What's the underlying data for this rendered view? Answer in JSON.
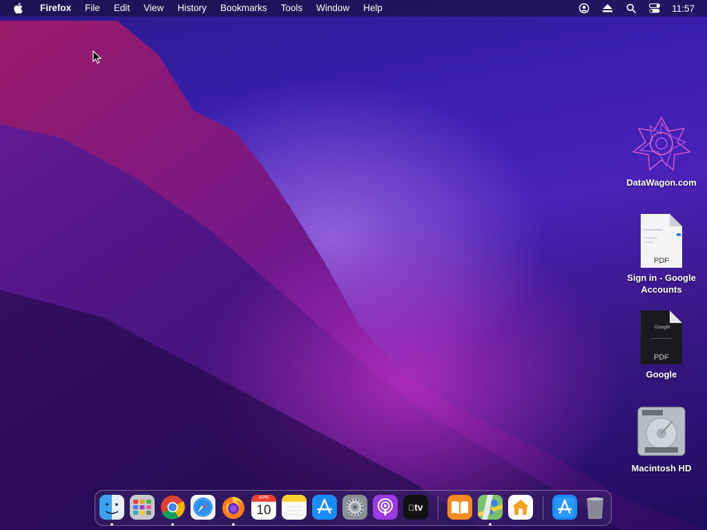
{
  "menubar": {
    "apple_icon": "apple-logo-icon",
    "app_name": "Firefox",
    "menus": [
      "File",
      "Edit",
      "View",
      "History",
      "Bookmarks",
      "Tools",
      "Window",
      "Help"
    ],
    "status_icons": [
      "user-account-icon",
      "eject-icon",
      "spotlight-search-icon",
      "control-center-icon"
    ],
    "clock": "11:57"
  },
  "desktop": {
    "icons": [
      {
        "name": "datawagon-icon",
        "label": "DataWagon.com",
        "kind": "app"
      },
      {
        "name": "pdf-sign-in-icon",
        "label": "Sign in - Google Accounts",
        "kind": "pdf",
        "tag": "PDF"
      },
      {
        "name": "pdf-google-icon",
        "label": "Google",
        "kind": "pdf-dark",
        "tag": "PDF"
      },
      {
        "name": "macintosh-hd-icon",
        "label": "Macintosh HD",
        "kind": "disk"
      }
    ]
  },
  "dock": {
    "apps": [
      {
        "name": "finder-icon",
        "running": true
      },
      {
        "name": "launchpad-icon",
        "running": false
      },
      {
        "name": "chrome-icon",
        "running": true
      },
      {
        "name": "safari-icon",
        "running": false
      },
      {
        "name": "firefox-icon",
        "running": true
      },
      {
        "name": "calendar-icon",
        "running": false,
        "month": "APR",
        "day": "10"
      },
      {
        "name": "notes-icon",
        "running": false
      },
      {
        "name": "app-store-icon",
        "running": false
      },
      {
        "name": "system-preferences-icon",
        "running": false
      },
      {
        "name": "podcasts-icon",
        "running": false
      },
      {
        "name": "apple-tv-icon",
        "running": false,
        "text": "tv"
      },
      {
        "name": "books-icon",
        "running": false
      },
      {
        "name": "maps-icon",
        "running": true
      },
      {
        "name": "home-icon",
        "running": false
      },
      {
        "name": "app-store-downloads-icon",
        "running": false
      },
      {
        "name": "trash-icon",
        "running": false
      }
    ]
  }
}
